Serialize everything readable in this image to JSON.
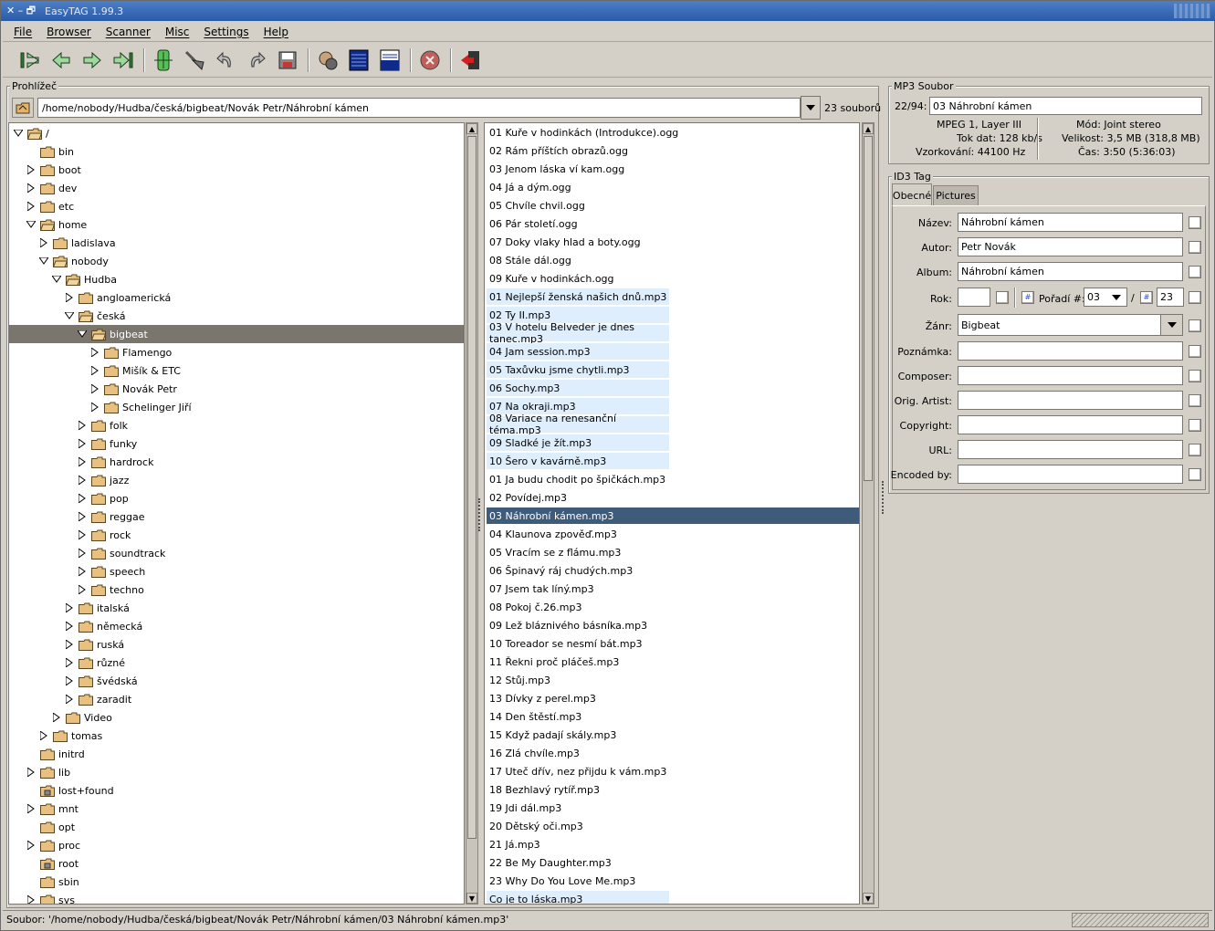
{
  "window": {
    "title": "EasyTAG 1.99.3",
    "controls": "✕ – 🗗"
  },
  "menu": [
    "File",
    "Browser",
    "Scanner",
    "Misc",
    "Settings",
    "Help"
  ],
  "toolbar": [
    "first-icon",
    "previous-icon",
    "next-icon",
    "last-icon",
    "scan-icon",
    "remove-tags-icon",
    "undo-icon",
    "redo-icon",
    "save-icon",
    "search-icon",
    "browse-dir-icon",
    "browse-tag-icon",
    "stop-icon",
    "quit-icon"
  ],
  "browser": {
    "label": "Prohlížeč",
    "path": "/home/nobody/Hudba/česká/bigbeat/Novák Petr/Náhrobní kámen",
    "count": "23 souborů",
    "tree": [
      {
        "name": "/",
        "depth": 0,
        "exp": "open"
      },
      {
        "name": "bin",
        "depth": 1,
        "exp": "none"
      },
      {
        "name": "boot",
        "depth": 1,
        "exp": "closed"
      },
      {
        "name": "dev",
        "depth": 1,
        "exp": "closed"
      },
      {
        "name": "etc",
        "depth": 1,
        "exp": "closed"
      },
      {
        "name": "home",
        "depth": 1,
        "exp": "open"
      },
      {
        "name": "ladislava",
        "depth": 2,
        "exp": "closed"
      },
      {
        "name": "nobody",
        "depth": 2,
        "exp": "open"
      },
      {
        "name": "Hudba",
        "depth": 3,
        "exp": "open"
      },
      {
        "name": "angloamerická",
        "depth": 4,
        "exp": "closed"
      },
      {
        "name": "česká",
        "depth": 4,
        "exp": "open"
      },
      {
        "name": "bigbeat",
        "depth": 5,
        "exp": "open",
        "sel": true
      },
      {
        "name": "Flamengo",
        "depth": 6,
        "exp": "closed"
      },
      {
        "name": "Mišík & ETC",
        "depth": 6,
        "exp": "closed"
      },
      {
        "name": "Novák Petr",
        "depth": 6,
        "exp": "closed"
      },
      {
        "name": "Schelinger Jiří",
        "depth": 6,
        "exp": "closed"
      },
      {
        "name": "folk",
        "depth": 5,
        "exp": "closed"
      },
      {
        "name": "funky",
        "depth": 5,
        "exp": "closed"
      },
      {
        "name": "hardrock",
        "depth": 5,
        "exp": "closed"
      },
      {
        "name": "jazz",
        "depth": 5,
        "exp": "closed"
      },
      {
        "name": "pop",
        "depth": 5,
        "exp": "closed"
      },
      {
        "name": "reggae",
        "depth": 5,
        "exp": "closed"
      },
      {
        "name": "rock",
        "depth": 5,
        "exp": "closed"
      },
      {
        "name": "soundtrack",
        "depth": 5,
        "exp": "closed"
      },
      {
        "name": "speech",
        "depth": 5,
        "exp": "closed"
      },
      {
        "name": "techno",
        "depth": 5,
        "exp": "closed"
      },
      {
        "name": "italská",
        "depth": 4,
        "exp": "closed"
      },
      {
        "name": "německá",
        "depth": 4,
        "exp": "closed"
      },
      {
        "name": "ruská",
        "depth": 4,
        "exp": "closed"
      },
      {
        "name": "různé",
        "depth": 4,
        "exp": "closed"
      },
      {
        "name": "švédská",
        "depth": 4,
        "exp": "closed"
      },
      {
        "name": "zaradit",
        "depth": 4,
        "exp": "closed"
      },
      {
        "name": "Video",
        "depth": 3,
        "exp": "closed"
      },
      {
        "name": "tomas",
        "depth": 2,
        "exp": "closed"
      },
      {
        "name": "initrd",
        "depth": 1,
        "exp": "none"
      },
      {
        "name": "lib",
        "depth": 1,
        "exp": "closed"
      },
      {
        "name": "lost+found",
        "depth": 1,
        "exp": "none",
        "locked": true
      },
      {
        "name": "mnt",
        "depth": 1,
        "exp": "closed"
      },
      {
        "name": "opt",
        "depth": 1,
        "exp": "none"
      },
      {
        "name": "proc",
        "depth": 1,
        "exp": "closed"
      },
      {
        "name": "root",
        "depth": 1,
        "exp": "none",
        "locked": true
      },
      {
        "name": "sbin",
        "depth": 1,
        "exp": "none"
      },
      {
        "name": "sys",
        "depth": 1,
        "exp": "closed"
      }
    ],
    "files": [
      {
        "name": "01 Kuře v hodinkách (Introdukce).ogg",
        "t": "ogg"
      },
      {
        "name": "02 Rám příštích obrazů.ogg",
        "t": "ogg"
      },
      {
        "name": "03 Jenom láska ví kam.ogg",
        "t": "ogg"
      },
      {
        "name": "04 Já a dým.ogg",
        "t": "ogg"
      },
      {
        "name": "05 Chvíle chvil.ogg",
        "t": "ogg"
      },
      {
        "name": "06 Pár století.ogg",
        "t": "ogg"
      },
      {
        "name": "07 Doky vlaky hlad a boty.ogg",
        "t": "ogg"
      },
      {
        "name": "08 Stále dál.ogg",
        "t": "ogg"
      },
      {
        "name": "09 Kuře v hodinkách.ogg",
        "t": "ogg"
      },
      {
        "name": "01 Nejlepší ženská našich dnů.mp3",
        "t": "mp3"
      },
      {
        "name": "02 Ty II.mp3",
        "t": "mp3"
      },
      {
        "name": "03 V hotelu Belveder je dnes tanec.mp3",
        "t": "mp3"
      },
      {
        "name": "04 Jam session.mp3",
        "t": "mp3"
      },
      {
        "name": "05 Taxůvku jsme chytli.mp3",
        "t": "mp3"
      },
      {
        "name": "06 Sochy.mp3",
        "t": "mp3"
      },
      {
        "name": "07 Na okraji.mp3",
        "t": "mp3"
      },
      {
        "name": "08 Variace na renesanční téma.mp3",
        "t": "mp3"
      },
      {
        "name": "09 Sladké je žít.mp3",
        "t": "mp3"
      },
      {
        "name": "10 Šero v kavárně.mp3",
        "t": "mp3"
      },
      {
        "name": "01 Ja budu chodit po špičkách.mp3",
        "t": "ogg"
      },
      {
        "name": "02 Povídej.mp3",
        "t": "ogg"
      },
      {
        "name": "03 Náhrobní kámen.mp3",
        "t": "sel"
      },
      {
        "name": "04 Klaunova zpověď.mp3",
        "t": "ogg"
      },
      {
        "name": "05 Vracím se z flámu.mp3",
        "t": "ogg"
      },
      {
        "name": "06 Špinavý ráj chudých.mp3",
        "t": "ogg"
      },
      {
        "name": "07 Jsem tak líný.mp3",
        "t": "ogg"
      },
      {
        "name": "08 Pokoj č.26.mp3",
        "t": "ogg"
      },
      {
        "name": "09 Lež bláznivého básníka.mp3",
        "t": "ogg"
      },
      {
        "name": "10 Toreador se nesmí bát.mp3",
        "t": "ogg"
      },
      {
        "name": "11 Řekni proč pláčeš.mp3",
        "t": "ogg"
      },
      {
        "name": "12 Stůj.mp3",
        "t": "ogg"
      },
      {
        "name": "13 Dívky z perel.mp3",
        "t": "ogg"
      },
      {
        "name": "14 Den štěstí.mp3",
        "t": "ogg"
      },
      {
        "name": "15 Když padají skály.mp3",
        "t": "ogg"
      },
      {
        "name": "16 Zlá chvíle.mp3",
        "t": "ogg"
      },
      {
        "name": "17 Uteč dřív, nez přijdu k vám.mp3",
        "t": "ogg"
      },
      {
        "name": "18 Bezhlavý rytíř.mp3",
        "t": "ogg"
      },
      {
        "name": "19 Jdi dál.mp3",
        "t": "ogg"
      },
      {
        "name": "20 Dětský oči.mp3",
        "t": "ogg"
      },
      {
        "name": "21 Já.mp3",
        "t": "ogg"
      },
      {
        "name": "22 Be My Daughter.mp3",
        "t": "ogg"
      },
      {
        "name": "23 Why Do You Love Me.mp3",
        "t": "ogg"
      },
      {
        "name": "Co je to láska.mp3",
        "t": "mp3"
      }
    ]
  },
  "mp3": {
    "label": "MP3 Soubor",
    "position": "22/94:",
    "filename": "03 Náhrobní kámen",
    "format": "MPEG 1, Layer III",
    "bitrate": "Tok dat: 128 kb/s",
    "samplerate": "Vzorkování: 44100 Hz",
    "mode": "Mód: Joint stereo",
    "size": "Velikost: 3,5 MB (318,8 MB)",
    "time": "Čas: 3:50 (5:36:03)"
  },
  "id3": {
    "label": "ID3 Tag",
    "tab_general": "Obecné",
    "tab_pictures": "Pictures",
    "title_label": "Název:",
    "title": "Náhrobní kámen",
    "artist_label": "Autor:",
    "artist": "Petr Novák",
    "album_label": "Album:",
    "album": "Náhrobní kámen",
    "year_label": "Rok:",
    "year": "",
    "track_label": "Pořadí #:",
    "track": "03",
    "slash": "/",
    "track_total": "23",
    "genre_label": "Žánr:",
    "genre": "Bigbeat",
    "comment_label": "Poznámka:",
    "comment": "",
    "composer_label": "Composer:",
    "composer": "",
    "orig_artist_label": "Orig. Artist:",
    "orig_artist": "",
    "copyright_label": "Copyright:",
    "copyright": "",
    "url_label": "URL:",
    "url": "",
    "encoded_label": "Encoded by:",
    "encoded": ""
  },
  "status": "Soubor: '/home/nobody/Hudba/česká/bigbeat/Novák Petr/Náhrobní kámen/03 Náhrobní kámen.mp3'"
}
